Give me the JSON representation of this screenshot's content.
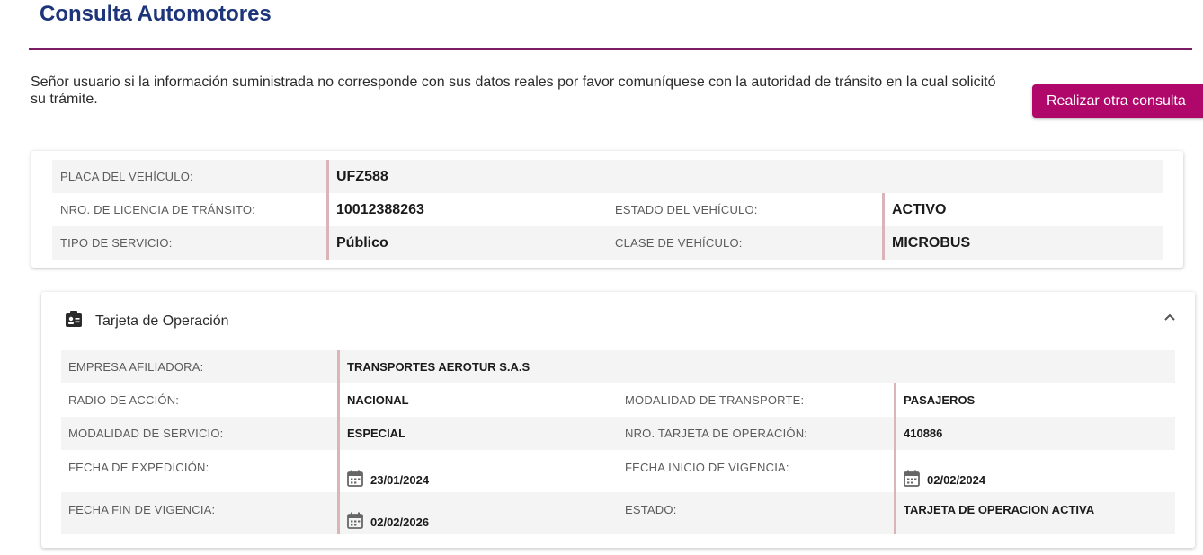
{
  "header": {
    "title": "Consulta Automotores"
  },
  "notice": "Señor usuario si la información suministrada no corresponde con sus datos reales por favor comuníquese con la autoridad de tránsito en la cual solicitó su trámite.",
  "actions": {
    "new_query": "Realizar otra consulta"
  },
  "vehicle": {
    "plate_label": "PLACA DEL VEHÍCULO:",
    "plate": "UFZ588",
    "license_label": "NRO. DE LICENCIA DE TRÁNSITO:",
    "license": "10012388263",
    "state_label": "ESTADO DEL VEHÍCULO:",
    "state": "ACTIVO",
    "service_label": "TIPO DE SERVICIO:",
    "service": "Público",
    "class_label": "CLASE DE VEHÍCULO:",
    "class": "MICROBUS"
  },
  "operation_card": {
    "title": "Tarjeta de Operación",
    "icon": "id-badge-icon",
    "company_label": "EMPRESA AFILIADORA:",
    "company": "TRANSPORTES AEROTUR S.A.S",
    "range_label": "RADIO DE ACCIÓN:",
    "range": "NACIONAL",
    "transport_label": "MODALIDAD DE TRANSPORTE:",
    "transport": "PASAJEROS",
    "service_mode_label": "MODALIDAD DE SERVICIO:",
    "service_mode": "ESPECIAL",
    "card_number_label": "NRO. TARJETA DE OPERACIÓN:",
    "card_number": "410886",
    "issue_date_label": "FECHA DE EXPEDICIÓN:",
    "issue_date": "23/01/2024",
    "start_date_label": "FECHA INICIO DE VIGENCIA:",
    "start_date": "02/02/2024",
    "end_date_label": "FECHA FIN DE VIGENCIA:",
    "end_date": "02/02/2026",
    "status_label": "ESTADO:",
    "status": "TARJETA DE OPERACION ACTIVA"
  },
  "colors": {
    "title": "#1c3479",
    "accent": "#b0086a",
    "rule": "#7b1d66",
    "value_border": "#d9b5b9"
  }
}
